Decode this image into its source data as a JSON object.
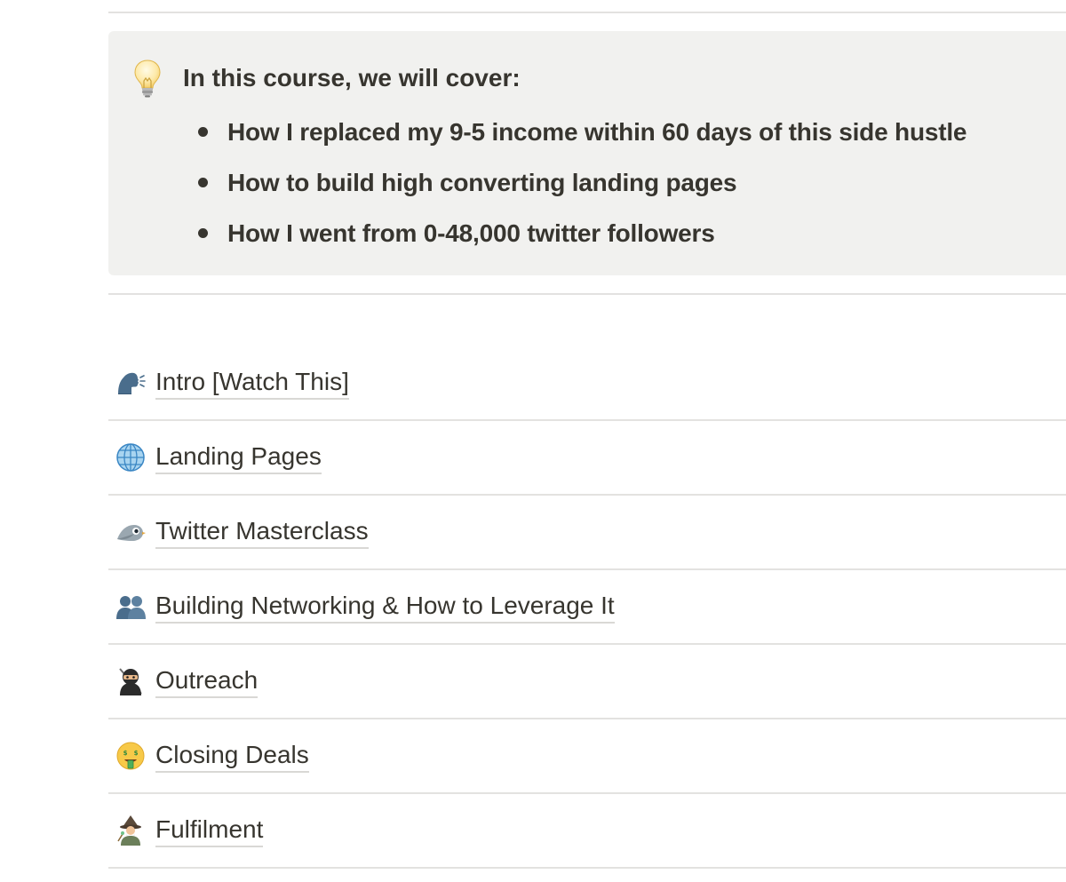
{
  "callout": {
    "icon": "lightbulb-icon",
    "title": "In this course, we will cover:",
    "bullets": [
      "How I replaced my 9-5 income within 60 days of this side hustle",
      "How to build high converting landing pages",
      "How I went from 0-48,000 twitter followers"
    ]
  },
  "pages": [
    {
      "label": "Intro [Watch This]",
      "icon": "speaking-head-icon"
    },
    {
      "label": "Landing Pages",
      "icon": "globe-icon"
    },
    {
      "label": "Twitter Masterclass",
      "icon": "bird-icon"
    },
    {
      "label": "Building Networking & How to Leverage It",
      "icon": "busts-in-silhouette-icon"
    },
    {
      "label": "Outreach",
      "icon": "ninja-icon"
    },
    {
      "label": "Closing Deals",
      "icon": "money-mouth-face-icon"
    },
    {
      "label": "Fulfilment",
      "icon": "mage-icon"
    }
  ]
}
